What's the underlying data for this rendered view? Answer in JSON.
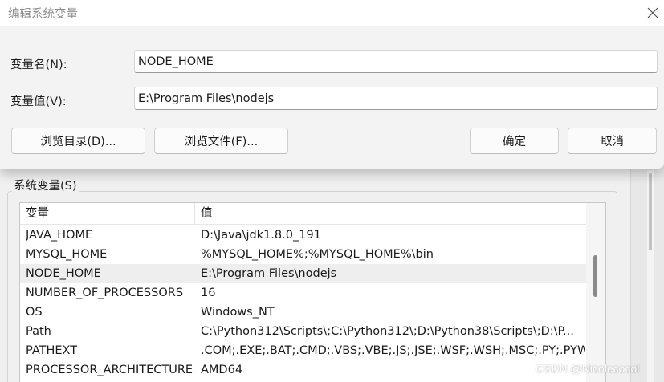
{
  "dialog": {
    "title": "编辑系统变量",
    "name_label": "变量名(N):",
    "name_value": "NODE_HOME",
    "value_label": "变量值(V):",
    "value_value": "E:\\Program Files\\nodejs",
    "buttons": {
      "browse_dir": "浏览目录(D)...",
      "browse_file": "浏览文件(F)...",
      "ok": "确定",
      "cancel": "取消"
    }
  },
  "system_vars": {
    "group_label": "系统变量(S)",
    "columns": {
      "name": "变量",
      "value": "值"
    },
    "selected_index": 2,
    "rows": [
      {
        "name": "JAVA_HOME",
        "value": "D:\\Java\\jdk1.8.0_191"
      },
      {
        "name": "MYSQL_HOME",
        "value": "%MYSQL_HOME%;%MYSQL_HOME%\\bin"
      },
      {
        "name": "NODE_HOME",
        "value": "E:\\Program Files\\nodejs"
      },
      {
        "name": "NUMBER_OF_PROCESSORS",
        "value": "16"
      },
      {
        "name": "OS",
        "value": "Windows_NT"
      },
      {
        "name": "Path",
        "value": "C:\\Python312\\Scripts\\;C:\\Python312\\;D:\\Python38\\Scripts\\;D:\\P..."
      },
      {
        "name": "PATHEXT",
        "value": ".COM;.EXE;.BAT;.CMD;.VBS;.VBE;.JS;.JSE;.WSF;.WSH;.MSC;.PY;.PYW"
      },
      {
        "name": "PROCESSOR_ARCHITECTURE",
        "value": "AMD64"
      }
    ]
  },
  "watermark": "CSDN @Nicolecocol",
  "icons": {
    "close": "close-icon"
  }
}
